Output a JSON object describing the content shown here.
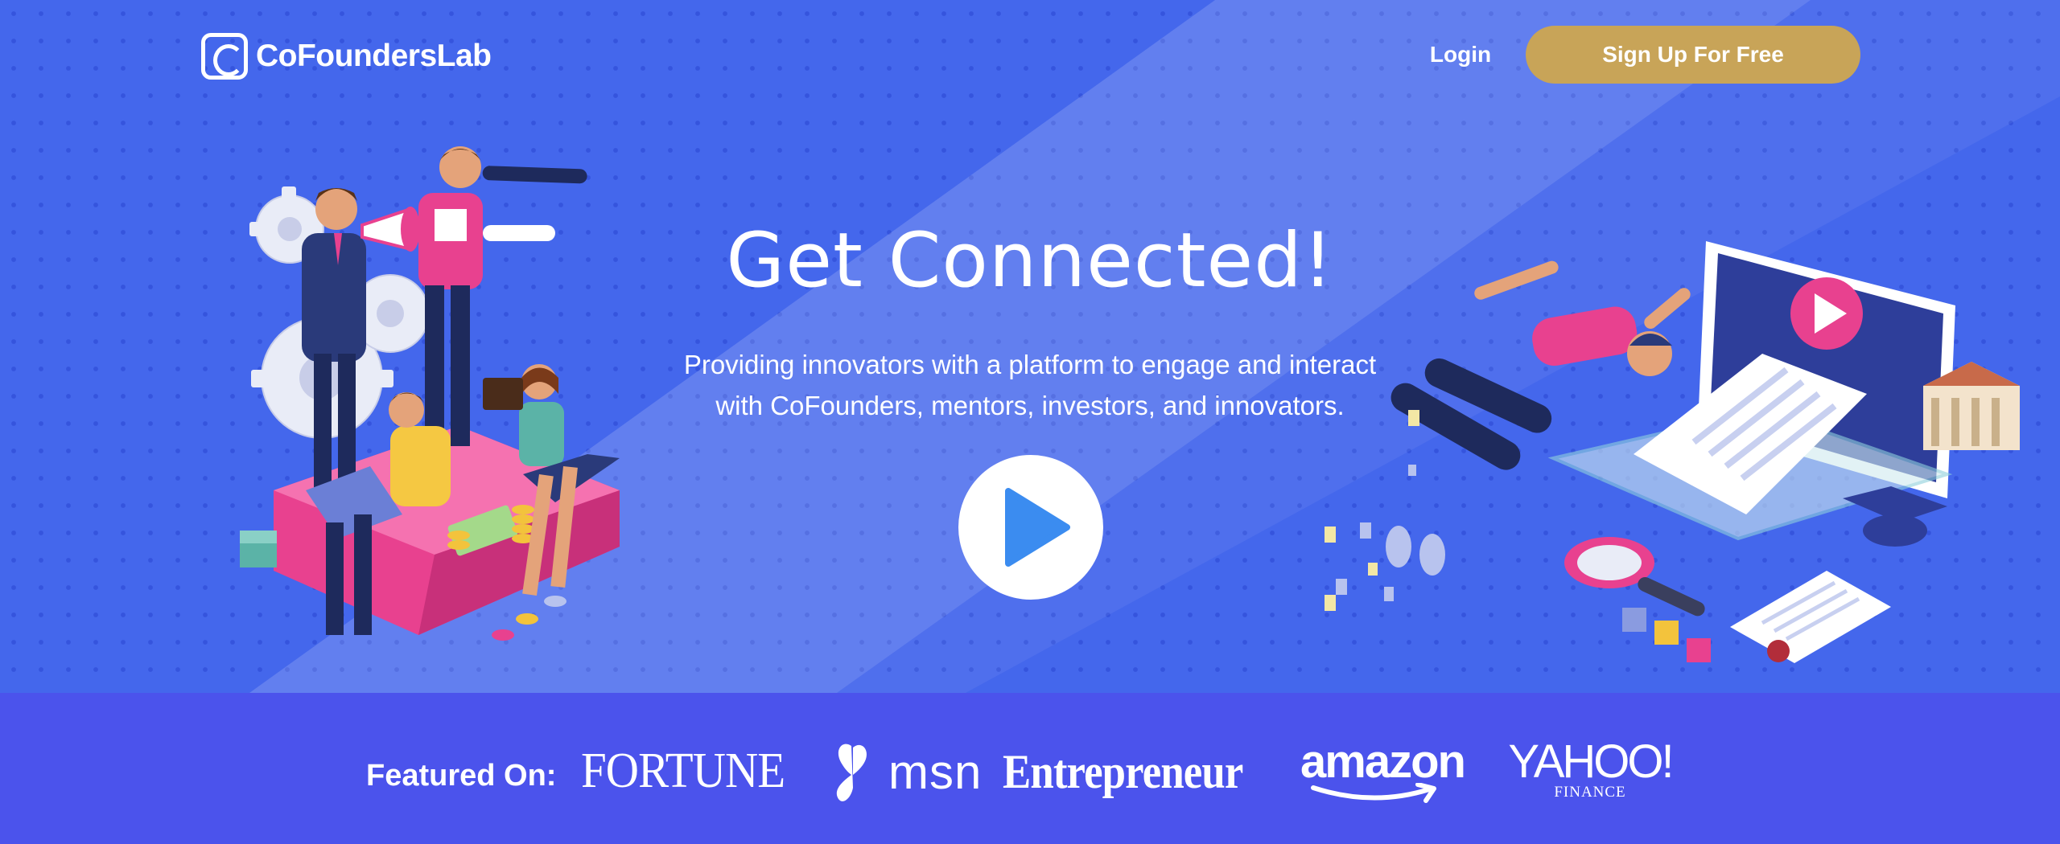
{
  "brand": {
    "name": "CoFoundersLab",
    "colors": {
      "hero_bg": "#4467ec",
      "featured_bg": "#4b53ec",
      "signup_button": "#c8a458",
      "play_triangle": "#3b8cf0",
      "accent_pink": "#e8418f"
    }
  },
  "header": {
    "login_label": "Login",
    "signup_label": "Sign Up For Free"
  },
  "hero": {
    "title": "Get Connected!",
    "subtitle_line1": "Providing innovators with a platform to engage and interact",
    "subtitle_line2": "with CoFounders, mentors, investors, and innovators.",
    "play_icon": "play-icon"
  },
  "featured": {
    "label": "Featured On:",
    "logos": {
      "fortune": "FORTUNE",
      "msn": "msn",
      "entrepreneur": "Entrepreneur",
      "amazon": "amazon",
      "yahoo": "YAHOO!",
      "yahoo_sub": "FINANCE"
    }
  }
}
